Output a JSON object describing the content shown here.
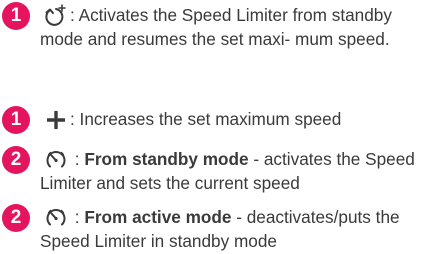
{
  "entries": [
    {
      "badge": "1",
      "icon": "resume-speed-icon",
      "text": ": Activates the Speed Limiter from standby mode and resumes the set maxi- mum speed."
    },
    {
      "badge": "1",
      "icon": "plus-icon",
      "text": ": Increases the set maximum speed"
    },
    {
      "badge": "2",
      "icon": "speed-limiter-icon",
      "sep": " : ",
      "bold": "From standby mode",
      "text": " - activates the Speed Limiter and sets the current speed"
    },
    {
      "badge": "2",
      "icon": "speed-limiter-icon",
      "sep": " : ",
      "bold": "From active mode",
      "text": " - deactivates/puts the Speed Limiter in standby mode"
    }
  ],
  "colors": {
    "badge": "#e4155e",
    "text": "#3a3a3a"
  }
}
